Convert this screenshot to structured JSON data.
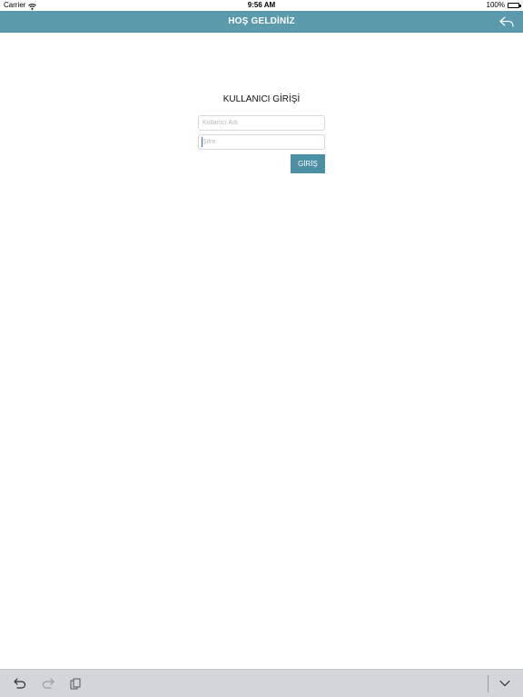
{
  "status_bar": {
    "carrier": "Carrier",
    "time": "9:56 AM",
    "battery": "100%"
  },
  "nav": {
    "title": "HOŞ GELDİNİZ",
    "back_icon": "reply-arrow-icon",
    "bar_color": "#5a9aaa"
  },
  "login": {
    "title": "KULLANICI GİRİŞİ",
    "username_placeholder": "Kullanıcı Adı",
    "username_value": "",
    "password_placeholder": "Şifre",
    "password_value": "",
    "submit_label": "GİRİŞ",
    "button_color": "#4a8fa3"
  },
  "keyboard_bar": {
    "undo_icon": "undo-icon",
    "redo_icon": "redo-icon",
    "paste_icon": "paste-icon",
    "dismiss_icon": "chevron-down-icon"
  }
}
